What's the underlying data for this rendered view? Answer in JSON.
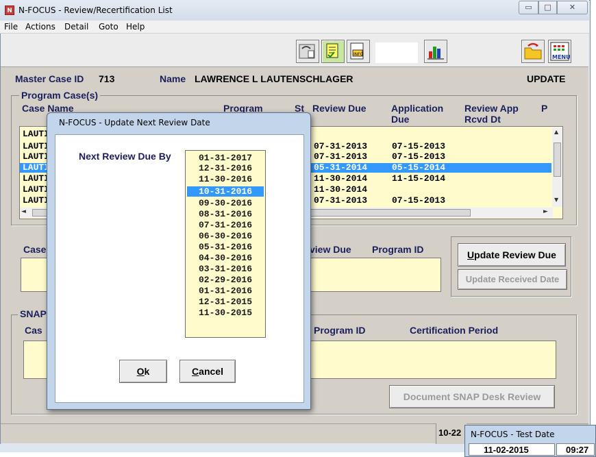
{
  "window": {
    "title": "N-FOCUS - Review/Recertification List",
    "icon_letter": "N"
  },
  "menu": [
    "File",
    "Actions",
    "Detail",
    "Goto",
    "Help"
  ],
  "toolbar": {
    "buttons": [
      "phone-notes-icon",
      "checklist-icon",
      "new-info-icon",
      "bar-chart-icon",
      "refresh-folder-icon",
      "menu-icon"
    ],
    "menu_icon_text": "MENU"
  },
  "header": {
    "master_case_label": "Master Case ID",
    "master_case_id": "713",
    "name_label": "Name",
    "name_value": "LAWRENCE L LAUTENSCHLAGER",
    "mode": "UPDATE"
  },
  "program_cases": {
    "group_label": "Program Case(s)",
    "columns": [
      "Case Name",
      "Program",
      "St",
      "Review Due",
      "Application Due",
      "Review App Rcvd Dt",
      "P"
    ],
    "col_application_line1": "Application",
    "col_application_line2": "Due",
    "col_reviewapp_line1": "Review App",
    "col_reviewapp_line2": "Rcvd Dt",
    "rows": [
      {
        "name": "LAUTI",
        "review_due": "",
        "application_due": ""
      },
      {
        "name": "LAUTI",
        "review_due": "07-31-2013",
        "application_due": "07-15-2013"
      },
      {
        "name": "LAUTI",
        "review_due": "07-31-2013",
        "application_due": "07-15-2013"
      },
      {
        "name": "LAUTI",
        "review_due": "05-31-2014",
        "application_due": "05-15-2014"
      },
      {
        "name": "LAUTI",
        "review_due": "11-30-2014",
        "application_due": "11-15-2014"
      },
      {
        "name": "LAUTI",
        "review_due": "11-30-2014",
        "application_due": ""
      },
      {
        "name": "LAUTI",
        "review_due": "07-31-2013",
        "application_due": "07-15-2013"
      }
    ]
  },
  "middle": {
    "col_case": "Case",
    "col_review_due": "view Due",
    "col_program_id": "Program ID",
    "btn_update_review_due": "Update Review Due",
    "btn_update_review_due_u": "U",
    "btn_update_review_due_rest": "pdate Review Due",
    "btn_update_received_date": "Update Received Date"
  },
  "snap": {
    "group_label": "SNAP",
    "col_case": "Cas",
    "col_program_id": "Program ID",
    "col_certification": "Certification Period",
    "btn_document": "Document SNAP Desk Review"
  },
  "status": {
    "date_fragment": "10-22"
  },
  "dialog": {
    "title": "N-FOCUS - Update Next Review Date",
    "label": "Next Review Due By",
    "dates": [
      "01-31-2017",
      "12-31-2016",
      "11-30-2016",
      "10-31-2016",
      "09-30-2016",
      "08-31-2016",
      "07-31-2016",
      "06-30-2016",
      "05-31-2016",
      "04-30-2016",
      "03-31-2016",
      "02-29-2016",
      "01-31-2016",
      "12-31-2015",
      "11-30-2015"
    ],
    "selected_index": 3,
    "ok_u": "O",
    "ok_rest": "k",
    "cancel_u": "C",
    "cancel_rest": "ancel"
  },
  "test_date_popup": {
    "title": "N-FOCUS - Test Date",
    "date": "11-02-2015",
    "time": "09:27"
  }
}
